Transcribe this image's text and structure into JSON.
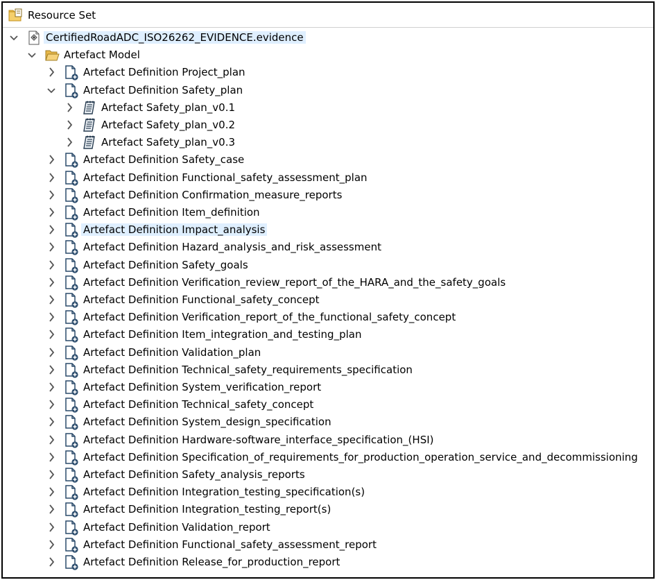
{
  "header": {
    "title": "Resource Set",
    "icon": "resource-set-icon"
  },
  "tree": {
    "root": {
      "label": "CertifiedRoadADC_ISO26262_EVIDENCE.evidence",
      "icon": "evidence-file-icon",
      "expanded": true
    },
    "model": {
      "label": "Artefact Model",
      "icon": "open-folder-icon",
      "expanded": true
    },
    "definitions": [
      {
        "label": "Artefact Definition Project_plan"
      },
      {
        "label": "Artefact Definition Safety_plan",
        "expanded": true,
        "children": [
          {
            "label": "Artefact Safety_plan_v0.1"
          },
          {
            "label": "Artefact Safety_plan_v0.2"
          },
          {
            "label": "Artefact Safety_plan_v0.3"
          }
        ]
      },
      {
        "label": "Artefact Definition Safety_case"
      },
      {
        "label": "Artefact Definition Functional_safety_assessment_plan"
      },
      {
        "label": "Artefact Definition Confirmation_measure_reports"
      },
      {
        "label": "Artefact Definition Item_definition"
      },
      {
        "label": "Artefact Definition Impact_analysis",
        "highlighted": true
      },
      {
        "label": "Artefact Definition Hazard_analysis_and_risk_assessment"
      },
      {
        "label": "Artefact Definition Safety_goals"
      },
      {
        "label": "Artefact Definition Verification_review_report_of_the_HARA_and_the_safety_goals"
      },
      {
        "label": "Artefact Definition Functional_safety_concept"
      },
      {
        "label": "Artefact Definition Verification_report_of_the_functional_safety_concept"
      },
      {
        "label": "Artefact Definition Item_integration_and_testing_plan"
      },
      {
        "label": "Artefact Definition Validation_plan"
      },
      {
        "label": "Artefact Definition Technical_safety_requirements_specification"
      },
      {
        "label": "Artefact Definition System_verification_report"
      },
      {
        "label": "Artefact Definition Technical_safety_concept"
      },
      {
        "label": "Artefact Definition System_design_specification"
      },
      {
        "label": "Artefact Definition Hardware-software_interface_specification_(HSI)"
      },
      {
        "label": "Artefact Definition Specification_of_requirements_for_production_operation_service_and_decommissioning"
      },
      {
        "label": "Artefact Definition Safety_analysis_reports"
      },
      {
        "label": "Artefact Definition Integration_testing_specification(s)"
      },
      {
        "label": "Artefact Definition Integration_testing_report(s)"
      },
      {
        "label": "Artefact Definition Validation_report"
      },
      {
        "label": "Artefact Definition Functional_safety_assessment_report"
      },
      {
        "label": "Artefact Definition Release_for_production_report"
      }
    ]
  },
  "colors": {
    "highlight": "#dfefff",
    "twistie": "#555555",
    "folder": "#e8b84a",
    "doc_stroke": "#2a4a6a",
    "frame": "#000000"
  }
}
